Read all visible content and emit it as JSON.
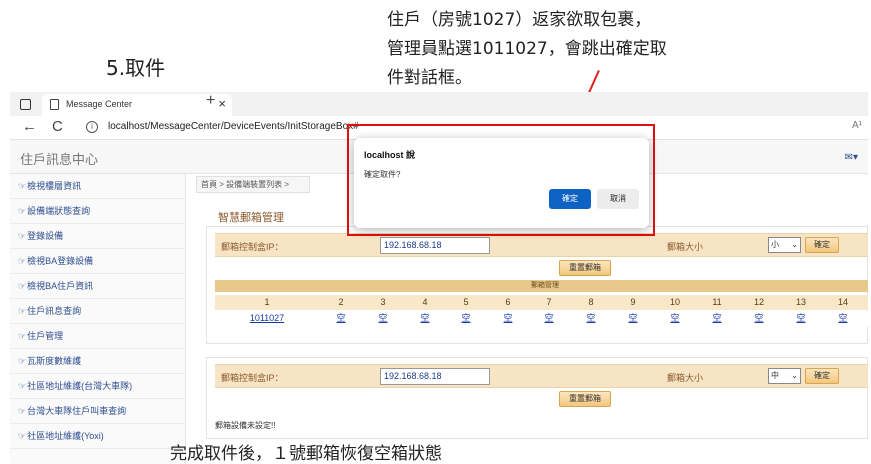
{
  "annotations": {
    "step": "5.取件",
    "top_note_lines": [
      "住戶（房號1027）返家欲取包裹，",
      "管理員點選1011027，會跳出確定取",
      "件對話框。"
    ],
    "bottom_note": "完成取件後，１號郵箱恢復空箱狀態"
  },
  "browser": {
    "tab_title": "Message Center",
    "tab_close": "×",
    "new_tab": "+",
    "back": "←",
    "reload": "C",
    "info": "i",
    "url": "localhost/MessageCenter/DeviceEvents/InitStorageBox#",
    "read_aloud": "A¹"
  },
  "app": {
    "title": "住戶訊息中心",
    "mail": "✉▾"
  },
  "sidebar": {
    "items": [
      {
        "icon": "☞",
        "label": "檢視樓層資訊"
      },
      {
        "icon": "☞",
        "label": "設備端狀態查詢"
      },
      {
        "icon": "☞",
        "label": "登錄設備"
      },
      {
        "icon": "☞",
        "label": "檢視BA登錄設備"
      },
      {
        "icon": "☞",
        "label": "檢視BA住戶資訊"
      },
      {
        "icon": "☞",
        "label": "住戶訊息查詢"
      },
      {
        "icon": "☞",
        "label": "住戶管理"
      },
      {
        "icon": "☞",
        "label": "瓦斯度數維護"
      },
      {
        "icon": "☞",
        "label": "社區地址維護(台灣大車隊)"
      },
      {
        "icon": "☞",
        "label": "台灣大車隊住戶叫車查詢"
      },
      {
        "icon": "☞",
        "label": "社區地址維護(Yoxi)"
      }
    ]
  },
  "content": {
    "breadcrumb": "首頁 > 設備端裝置列表 >",
    "section_title": "智慧郵箱管理",
    "panel1": {
      "ip_label": "郵箱控制盒IP：",
      "ip_value": "192.168.68.18",
      "size_label": "郵箱大小",
      "size_value": "小",
      "confirm": "確定",
      "reset": "重置郵箱",
      "mgmt_header": "郵箱管理",
      "numbers": [
        "1",
        "2",
        "3",
        "4",
        "5",
        "6",
        "7",
        "8",
        "9",
        "10",
        "11",
        "12",
        "13",
        "14"
      ],
      "boxes": [
        "1011027",
        "空",
        "空",
        "空",
        "空",
        "空",
        "空",
        "空",
        "空",
        "空",
        "空",
        "空",
        "空",
        "空"
      ]
    },
    "panel2": {
      "ip_label": "郵箱控制盒IP：",
      "ip_value": "192.168.68.18",
      "size_label": "郵箱大小",
      "size_value": "中",
      "confirm": "確定",
      "reset": "重置郵箱",
      "status": "郵箱設備未設定!!"
    }
  },
  "dialog": {
    "title": "localhost 說",
    "message": "確定取件?",
    "ok": "確定",
    "cancel": "取消"
  },
  "colors": {
    "highlight_frame": "#e01010",
    "dialog_ok": "#0e62c4",
    "form_row": "#f7e4c4"
  }
}
